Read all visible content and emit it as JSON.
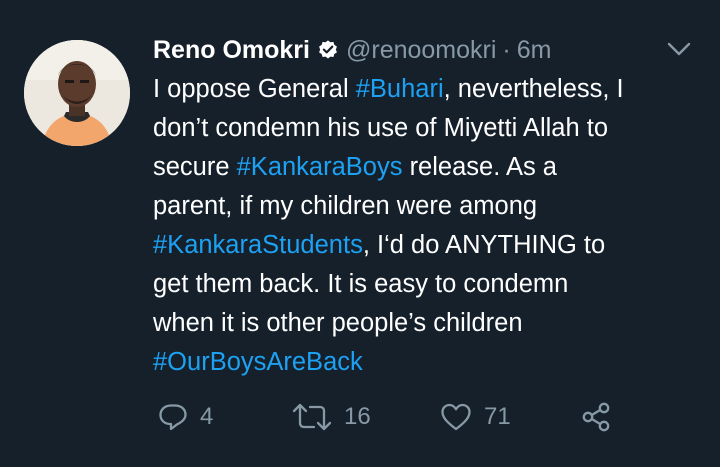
{
  "tweet": {
    "author_name": "Reno Omokri",
    "handle": "@renoomokri",
    "separator": "·",
    "time": "6m",
    "lines": [
      [
        {
          "t": "I oppose General ",
          "tag": false
        },
        {
          "t": "#Buhari",
          "tag": true
        },
        {
          "t": ", nevertheless, I",
          "tag": false
        }
      ],
      [
        {
          "t": "don’t condemn his use of Miyetti Allah to",
          "tag": false
        }
      ],
      [
        {
          "t": "secure ",
          "tag": false
        },
        {
          "t": "#KankaraBoys",
          "tag": true
        },
        {
          "t": " release. As a",
          "tag": false
        }
      ],
      [
        {
          "t": "parent, if my children were among",
          "tag": false
        }
      ],
      [
        {
          "t": "#KankaraStudents",
          "tag": true
        },
        {
          "t": ", I‘d do ANYTHING to",
          "tag": false
        }
      ],
      [
        {
          "t": "get them back. It is easy to condemn",
          "tag": false
        }
      ],
      [
        {
          "t": "when it is other people’s children",
          "tag": false
        }
      ],
      [
        {
          "t": "#OurBoysAreBack",
          "tag": true
        }
      ]
    ],
    "actions": {
      "reply_count": "4",
      "retweet_count": "16",
      "like_count": "71"
    }
  },
  "colors": {
    "background": "#15202b",
    "text": "#ffffff",
    "secondary": "#8899a6",
    "accent": "#1da1f2"
  },
  "icons": {
    "verified": "verified-badge-icon",
    "more": "chevron-down-icon",
    "reply": "reply-icon",
    "retweet": "retweet-icon",
    "like": "heart-icon",
    "share": "share-icon"
  }
}
